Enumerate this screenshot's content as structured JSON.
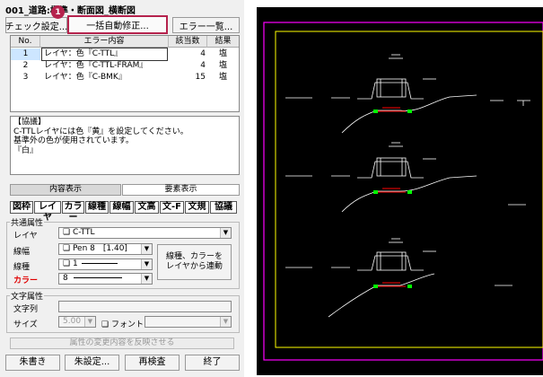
{
  "title": "001_道路:標準・断面図_横断図",
  "toolbar": {
    "check_settings": "チェック設定...",
    "auto_fix": "一括自動修正...",
    "error_list": "エラー一覧...",
    "step_number": "1"
  },
  "table": {
    "headers": [
      "No.",
      "エラー内容",
      "該当数",
      "結果"
    ],
    "rows": [
      {
        "no": "1",
        "content": "レイヤ：色『C-TTL』",
        "count": "4",
        "result": "塩"
      },
      {
        "no": "2",
        "content": "レイヤ：色『C-TTL-FRAM』",
        "count": "4",
        "result": "塩"
      },
      {
        "no": "3",
        "content": "レイヤ：色『C-BMK』",
        "count": "15",
        "result": "塩"
      }
    ]
  },
  "description": {
    "heading": "【協議】",
    "line1": "C-TTLレイヤには色『黄』を設定してください。",
    "line2": "基準外の色が使用されています。",
    "line3": "『白』"
  },
  "tabs": {
    "content": "内容表示",
    "element": "要素表示"
  },
  "categories": [
    "図枠",
    "レイヤ",
    "カラー",
    "線種",
    "線幅",
    "文高",
    "文-F",
    "文規",
    "協議"
  ],
  "common": {
    "group_label": "共通属性",
    "layer_label": "レイヤ",
    "layer_value": "C-TTL",
    "width_label": "線幅",
    "width_value": "Pen 8　[1.40]",
    "type_label": "線種",
    "type_value": "1",
    "color_label": "カラー",
    "color_value": "8",
    "link_button_line1": "線種、カラーを",
    "link_button_line2": "レイヤから連動"
  },
  "text_attr": {
    "group_label": "文字属性",
    "string_label": "文字列",
    "size_label": "サイズ",
    "size_value": "5.00",
    "font_label": "フォント"
  },
  "apply_button": "属性の変更内容を反映させる",
  "bottom_buttons": {
    "save": "朱書き",
    "red_settings": "朱設定...",
    "recheck": "再検査",
    "exit": "終了"
  },
  "colors": {
    "accent": "#b5234d",
    "frame_magenta": "#ff00ff",
    "frame_yellow": "#ffff00",
    "drawing_red": "#ff0000",
    "drawing_green": "#00ff00"
  }
}
